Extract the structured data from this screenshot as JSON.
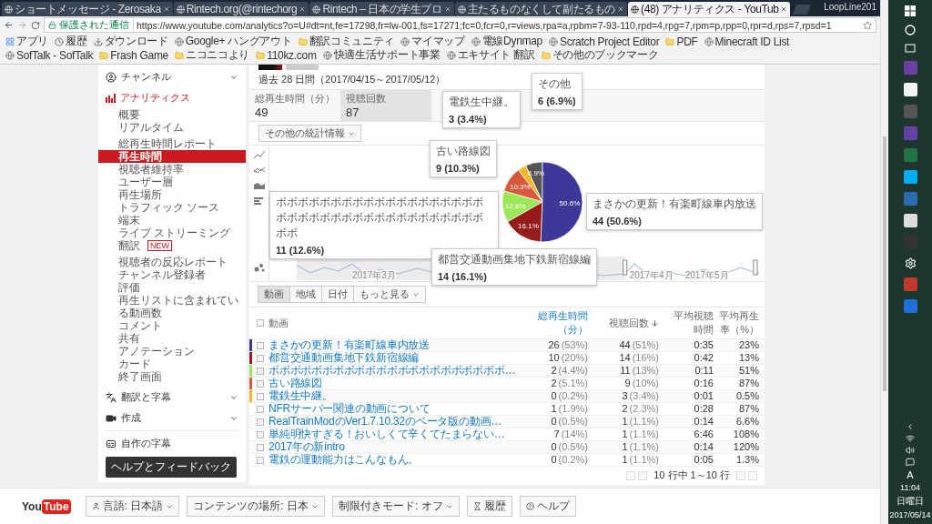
{
  "browser": {
    "tabs": [
      {
        "title": "ショートメッセージ - Zerosaka",
        "selected": false
      },
      {
        "title": "Rintech.org(@rintechorg",
        "selected": false
      },
      {
        "title": "Rintech – 日本の学生プロ",
        "selected": false
      },
      {
        "title": "主たるものなくして副たるもの",
        "selected": false
      },
      {
        "title": "(48) アナリティクス - YouTub",
        "selected": true
      }
    ],
    "user": "LoopLine201",
    "secure_label": "保護された通信",
    "url": "https://www.youtube.com/analytics?o=U#dt=nt,fe=17298,fr=lw-001,fs=17271;fc=0,fcr=0,r=views,rpa=a,rpbm=7-93-110,rpd=4,rpg=7,rpm=p,rpp=0,rpr=d,rps=7,rpsd=1",
    "bookmarks": [
      {
        "label": "アプリ",
        "kind": "apps"
      },
      {
        "label": "履歴",
        "kind": "history"
      },
      {
        "label": "ダウンロード",
        "kind": "download"
      },
      {
        "label": "Google+ ハングアウト",
        "kind": "site"
      },
      {
        "label": "翻訳コミュニティ",
        "kind": "folder"
      },
      {
        "label": "マイマップ",
        "kind": "site"
      },
      {
        "label": "電線Dynmap",
        "kind": "site"
      },
      {
        "label": "Scratch Project Editor",
        "kind": "site"
      },
      {
        "label": "PDF",
        "kind": "folder"
      },
      {
        "label": "Minecraft ID List",
        "kind": "site"
      },
      {
        "label": "SofTalk - SofTalk",
        "kind": "site"
      },
      {
        "label": "Frash Game",
        "kind": "folder"
      },
      {
        "label": "ニコニコより",
        "kind": "folder"
      },
      {
        "label": "110kz.com",
        "kind": "folder"
      },
      {
        "label": "快適生活サポート事業",
        "kind": "site"
      },
      {
        "label": "エキサイト 翻訳",
        "kind": "site"
      },
      {
        "label": "その他のブックマーク",
        "kind": "folder"
      }
    ]
  },
  "sidebar": {
    "channel": {
      "label": "チャンネル",
      "expanded": false
    },
    "analytics": {
      "label": "アナリティクス",
      "expanded": true,
      "groups": [
        [
          {
            "label": "概要",
            "selected": false
          },
          {
            "label": "リアルタイム",
            "selected": false
          }
        ],
        [
          {
            "label": "総再生時間レポート",
            "selected": false
          },
          {
            "label": "再生時間",
            "selected": true
          },
          {
            "label": "視聴者維持率",
            "selected": false
          },
          {
            "label": "ユーザー層",
            "selected": false
          },
          {
            "label": "再生場所",
            "selected": false
          },
          {
            "label": "トラフィック ソース",
            "selected": false
          },
          {
            "label": "端末",
            "selected": false
          },
          {
            "label": "ライブ ストリーミング",
            "selected": false
          },
          {
            "label": "翻訳",
            "selected": false,
            "badge": "NEW"
          }
        ],
        [
          {
            "label": "視聴者の反応レポート",
            "selected": false
          },
          {
            "label": "チャンネル登録者",
            "selected": false
          },
          {
            "label": "評価",
            "selected": false
          },
          {
            "label": "再生リストに含まれている動画数",
            "selected": false
          },
          {
            "label": "コメント",
            "selected": false
          },
          {
            "label": "共有",
            "selected": false
          },
          {
            "label": "アノテーション",
            "selected": false
          },
          {
            "label": "カード",
            "selected": false
          },
          {
            "label": "終了画面",
            "selected": false
          }
        ]
      ]
    },
    "sections": [
      {
        "label": "翻訳と字幕",
        "expanded": false
      },
      {
        "label": "作成",
        "expanded": false
      }
    ],
    "subtitles": {
      "label": "自作の字幕"
    },
    "help_button": "ヘルプとフィードバック"
  },
  "report": {
    "date_range": "過去 28 日間（2017/04/15～2017/05/12）",
    "metrics": [
      {
        "label": "総再生時間（分）",
        "value": "49",
        "selected": false
      },
      {
        "label": "視聴回数",
        "value": "87",
        "selected": true
      }
    ],
    "more_stats": "その他の統計情報"
  },
  "chart": {
    "chart_data": {
      "type": "pie",
      "categories": [
        "その他",
        "電鉄生中継。",
        "古い路線図",
        "ボボボボボボボボボボボボボボボボボボボボボボボボボボボボボボボボボボボボボボボボ",
        "都営交通動画集地下鉄新宿線編",
        "まさかの更新！有楽町線車内放送"
      ],
      "series": [
        {
          "values": [
            6.9,
            3.4,
            10.3,
            12.6,
            16.1,
            50.6
          ]
        }
      ],
      "colors": [
        "#555555",
        "#f5b72a",
        "#d9573b",
        "#9ce65a",
        "#961c1c",
        "#3d3897"
      ],
      "value_labels": [
        "6.9%",
        null,
        "10.3%",
        "12.6%",
        "16.1%",
        "50.6%"
      ]
    },
    "tooltip_values": [
      "6 (6.9%)",
      "3 (3.4%)",
      "9 (10.3%)",
      "11 (12.6%)",
      "14 (16.1%)",
      "44 (50.6%)"
    ],
    "timeline_labels": [
      "2017年3月",
      "2017年4月",
      "2017年5月"
    ]
  },
  "table": {
    "tabs": [
      {
        "label": "動画",
        "selected": true
      },
      {
        "label": "地域",
        "selected": false
      },
      {
        "label": "日付",
        "selected": false
      }
    ],
    "more_tab": "もっと見る",
    "header_checked": false,
    "columns": [
      {
        "label": "動画",
        "sorted": false,
        "highlighted": false
      },
      {
        "label": "総再生時間（分）",
        "sorted": false,
        "highlighted": true
      },
      {
        "label": "視聴回数",
        "sorted": true,
        "highlighted": false
      },
      {
        "label": "平均視聴時間",
        "sorted": false,
        "highlighted": false
      },
      {
        "label": "平均再生率（%）",
        "sorted": false,
        "highlighted": false
      }
    ],
    "rows": [
      {
        "title": "まさかの更新！有楽町線車内放送",
        "watch": "26",
        "watch_pct": "(53%)",
        "views": "44",
        "views_pct": "(51%)",
        "duration": "0:35",
        "rate": "23%",
        "checked": false,
        "color": "#3d3897"
      },
      {
        "title": "都営交通動画集地下鉄新宿線編",
        "watch": "10",
        "watch_pct": "(20%)",
        "views": "14",
        "views_pct": "(16%)",
        "duration": "0:42",
        "rate": "13%",
        "checked": false,
        "color": "#961c1c"
      },
      {
        "title": "ボボボボボボボボボボボボボボボボボボボボボボ…",
        "watch": "2",
        "watch_pct": "(4.4%)",
        "views": "11",
        "views_pct": "(13%)",
        "duration": "0:11",
        "rate": "51%",
        "checked": false,
        "color": "#9ce65a"
      },
      {
        "title": "古い路線図",
        "watch": "2",
        "watch_pct": "(5.1%)",
        "views": "9",
        "views_pct": "(10%)",
        "duration": "0:16",
        "rate": "87%",
        "checked": false,
        "color": "#d9573b"
      },
      {
        "title": "電鉄生中継。",
        "watch": "0",
        "watch_pct": "(0.2%)",
        "views": "3",
        "views_pct": "(3.4%)",
        "duration": "0:01",
        "rate": "0.5%",
        "checked": false,
        "color": "#f5b72a"
      },
      {
        "title": "NFRサーバー関連の動画について",
        "watch": "1",
        "watch_pct": "(1.9%)",
        "views": "2",
        "views_pct": "(2.3%)",
        "duration": "0:28",
        "rate": "87%",
        "checked": false
      },
      {
        "title": "RealTrainModのVer1.7.10.32のベータ版の動画…",
        "watch": "0",
        "watch_pct": "(0.5%)",
        "views": "1",
        "views_pct": "(1.1%)",
        "duration": "0:14",
        "rate": "6.6%",
        "checked": false
      },
      {
        "title": "単純明快すぎる！おいしくて辛くてたまらない…",
        "watch": "7",
        "watch_pct": "(14%)",
        "views": "1",
        "views_pct": "(1.1%)",
        "duration": "6:46",
        "rate": "108%",
        "checked": false
      },
      {
        "title": "2017年の新intro",
        "watch": "0",
        "watch_pct": "(0.5%)",
        "views": "1",
        "views_pct": "(1.1%)",
        "duration": "0:14",
        "rate": "120%",
        "checked": false
      },
      {
        "title": "電鉄の運動能力はこんなもん。",
        "watch": "0",
        "watch_pct": "(0.2%)",
        "views": "1",
        "views_pct": "(1.1%)",
        "duration": "0:05",
        "rate": "1.3%",
        "checked": false
      }
    ],
    "pagination": "10 行中 1～10 行"
  },
  "footer": {
    "logo_left": "You",
    "logo_right": "Tube",
    "buttons": [
      {
        "label": "言語: 日本語",
        "kind": "language"
      },
      {
        "label": "コンテンツの場所: 日本",
        "kind": "dropdown"
      },
      {
        "label": "制限付きモード: オフ",
        "kind": "dropdown"
      },
      {
        "label": "履歴",
        "kind": "history"
      },
      {
        "label": "ヘルプ",
        "kind": "help"
      }
    ]
  },
  "taskbar": {
    "ime": "A",
    "time": "11:04",
    "day": "日曜日",
    "date": "2017/05/14"
  }
}
